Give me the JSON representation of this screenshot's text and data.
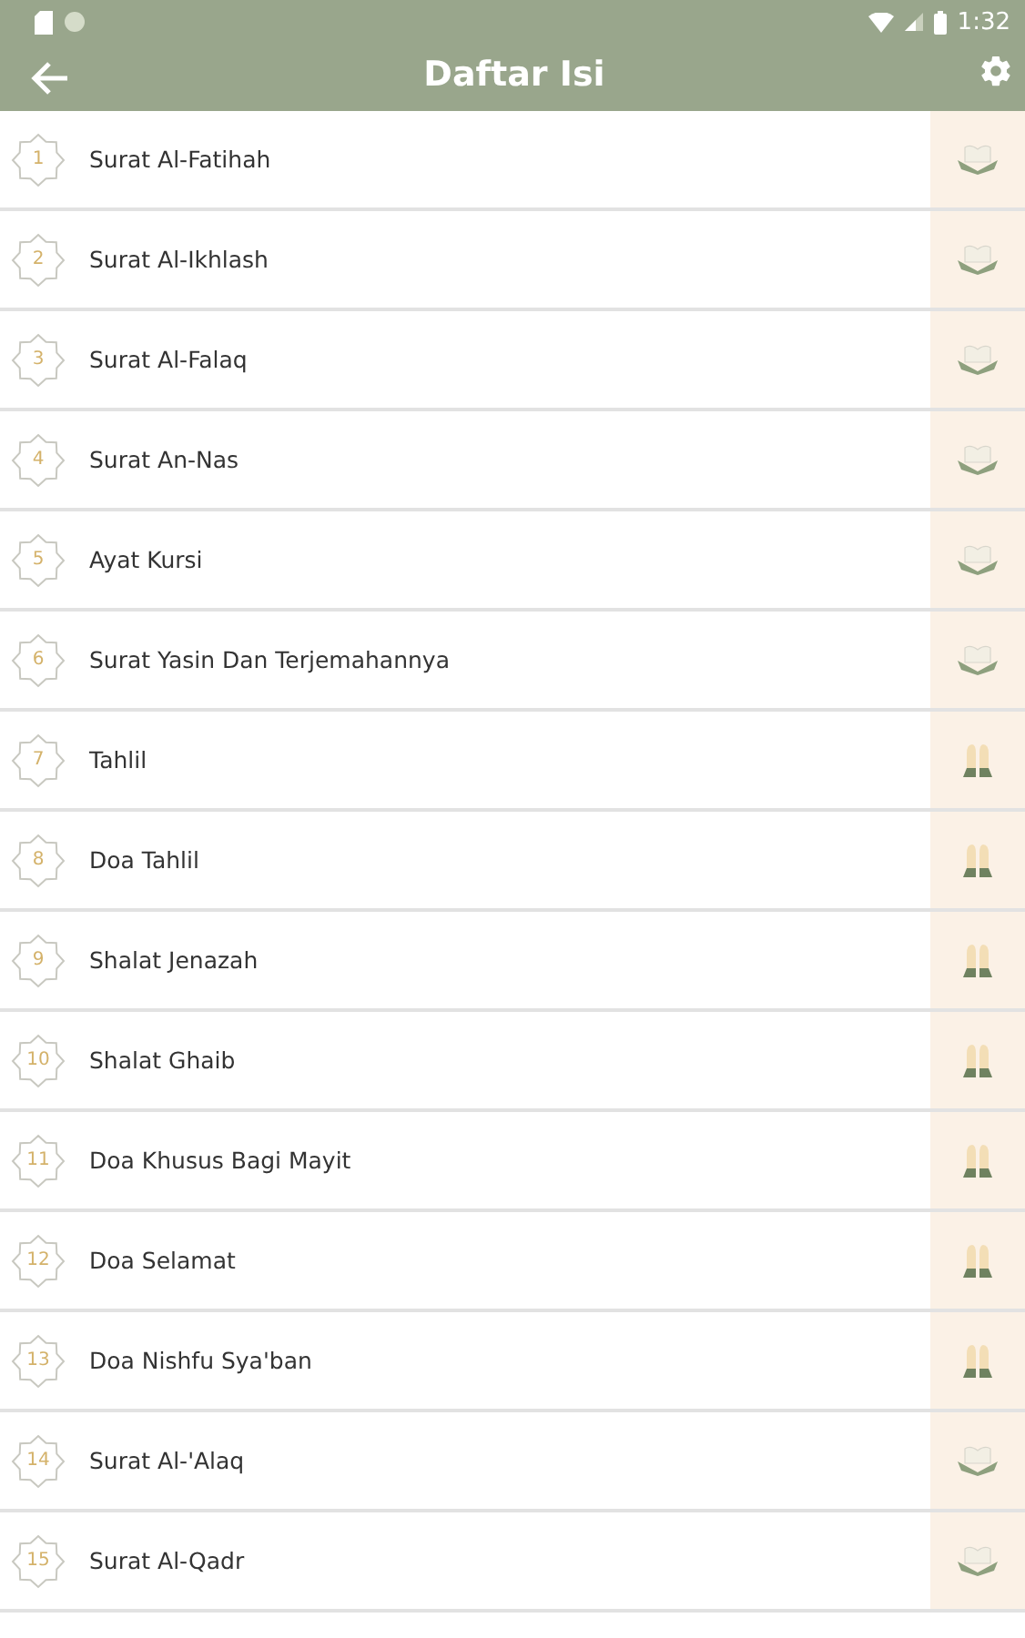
{
  "status_bar": {
    "time": "1:32"
  },
  "app_bar": {
    "title": "Daftar Isi"
  },
  "items": [
    {
      "number": "1",
      "title": "Surat Al-Fatihah",
      "kind": "book"
    },
    {
      "number": "2",
      "title": "Surat Al-Ikhlash",
      "kind": "book"
    },
    {
      "number": "3",
      "title": "Surat Al-Falaq",
      "kind": "book"
    },
    {
      "number": "4",
      "title": "Surat An-Nas",
      "kind": "book"
    },
    {
      "number": "5",
      "title": "Ayat Kursi",
      "kind": "book"
    },
    {
      "number": "6",
      "title": "Surat Yasin Dan Terjemahannya",
      "kind": "book"
    },
    {
      "number": "7",
      "title": "Tahlil",
      "kind": "hands"
    },
    {
      "number": "8",
      "title": "Doa Tahlil",
      "kind": "hands"
    },
    {
      "number": "9",
      "title": "Shalat Jenazah",
      "kind": "hands"
    },
    {
      "number": "10",
      "title": "Shalat Ghaib",
      "kind": "hands"
    },
    {
      "number": "11",
      "title": "Doa Khusus Bagi Mayit",
      "kind": "hands"
    },
    {
      "number": "12",
      "title": "Doa Selamat",
      "kind": "hands"
    },
    {
      "number": "13",
      "title": "Doa Nishfu Sya'ban",
      "kind": "hands"
    },
    {
      "number": "14",
      "title": "Surat Al-'Alaq",
      "kind": "book"
    },
    {
      "number": "15",
      "title": "Surat Al-Qadr",
      "kind": "book"
    }
  ]
}
